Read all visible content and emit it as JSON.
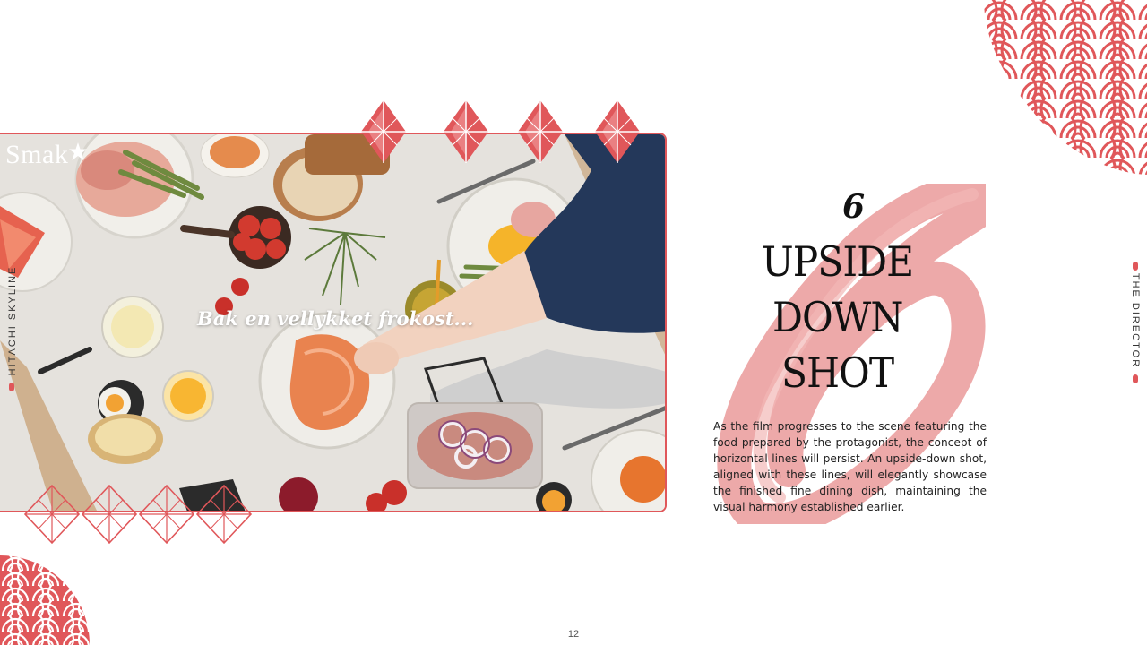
{
  "image": {
    "brand": "Smak",
    "caption": "Bak en vellykket frokost..."
  },
  "side_label_left": "HITACHI  SKYLINE",
  "number_mark": "6",
  "title_lines": [
    "UPSIDE",
    "DOWN",
    "SHOT"
  ],
  "body": "As the film progresses to the scene featuring the food prepared by the protagonist, the concept of horizontal lines will persist. An upside-down shot, aligned with these lines, will elegantly showcase the finished fine dining dish, maintaining the visual harmony established earlier.",
  "side_label_right": "THE DIRECTOR",
  "page_number": "12",
  "colors": {
    "accent": "#e0575a",
    "brush": "#ea9a9a",
    "text": "#111111"
  },
  "icons": [
    "seigaiha-wave-pattern",
    "diamond-star-ornament",
    "brush-stroke",
    "star-icon"
  ]
}
